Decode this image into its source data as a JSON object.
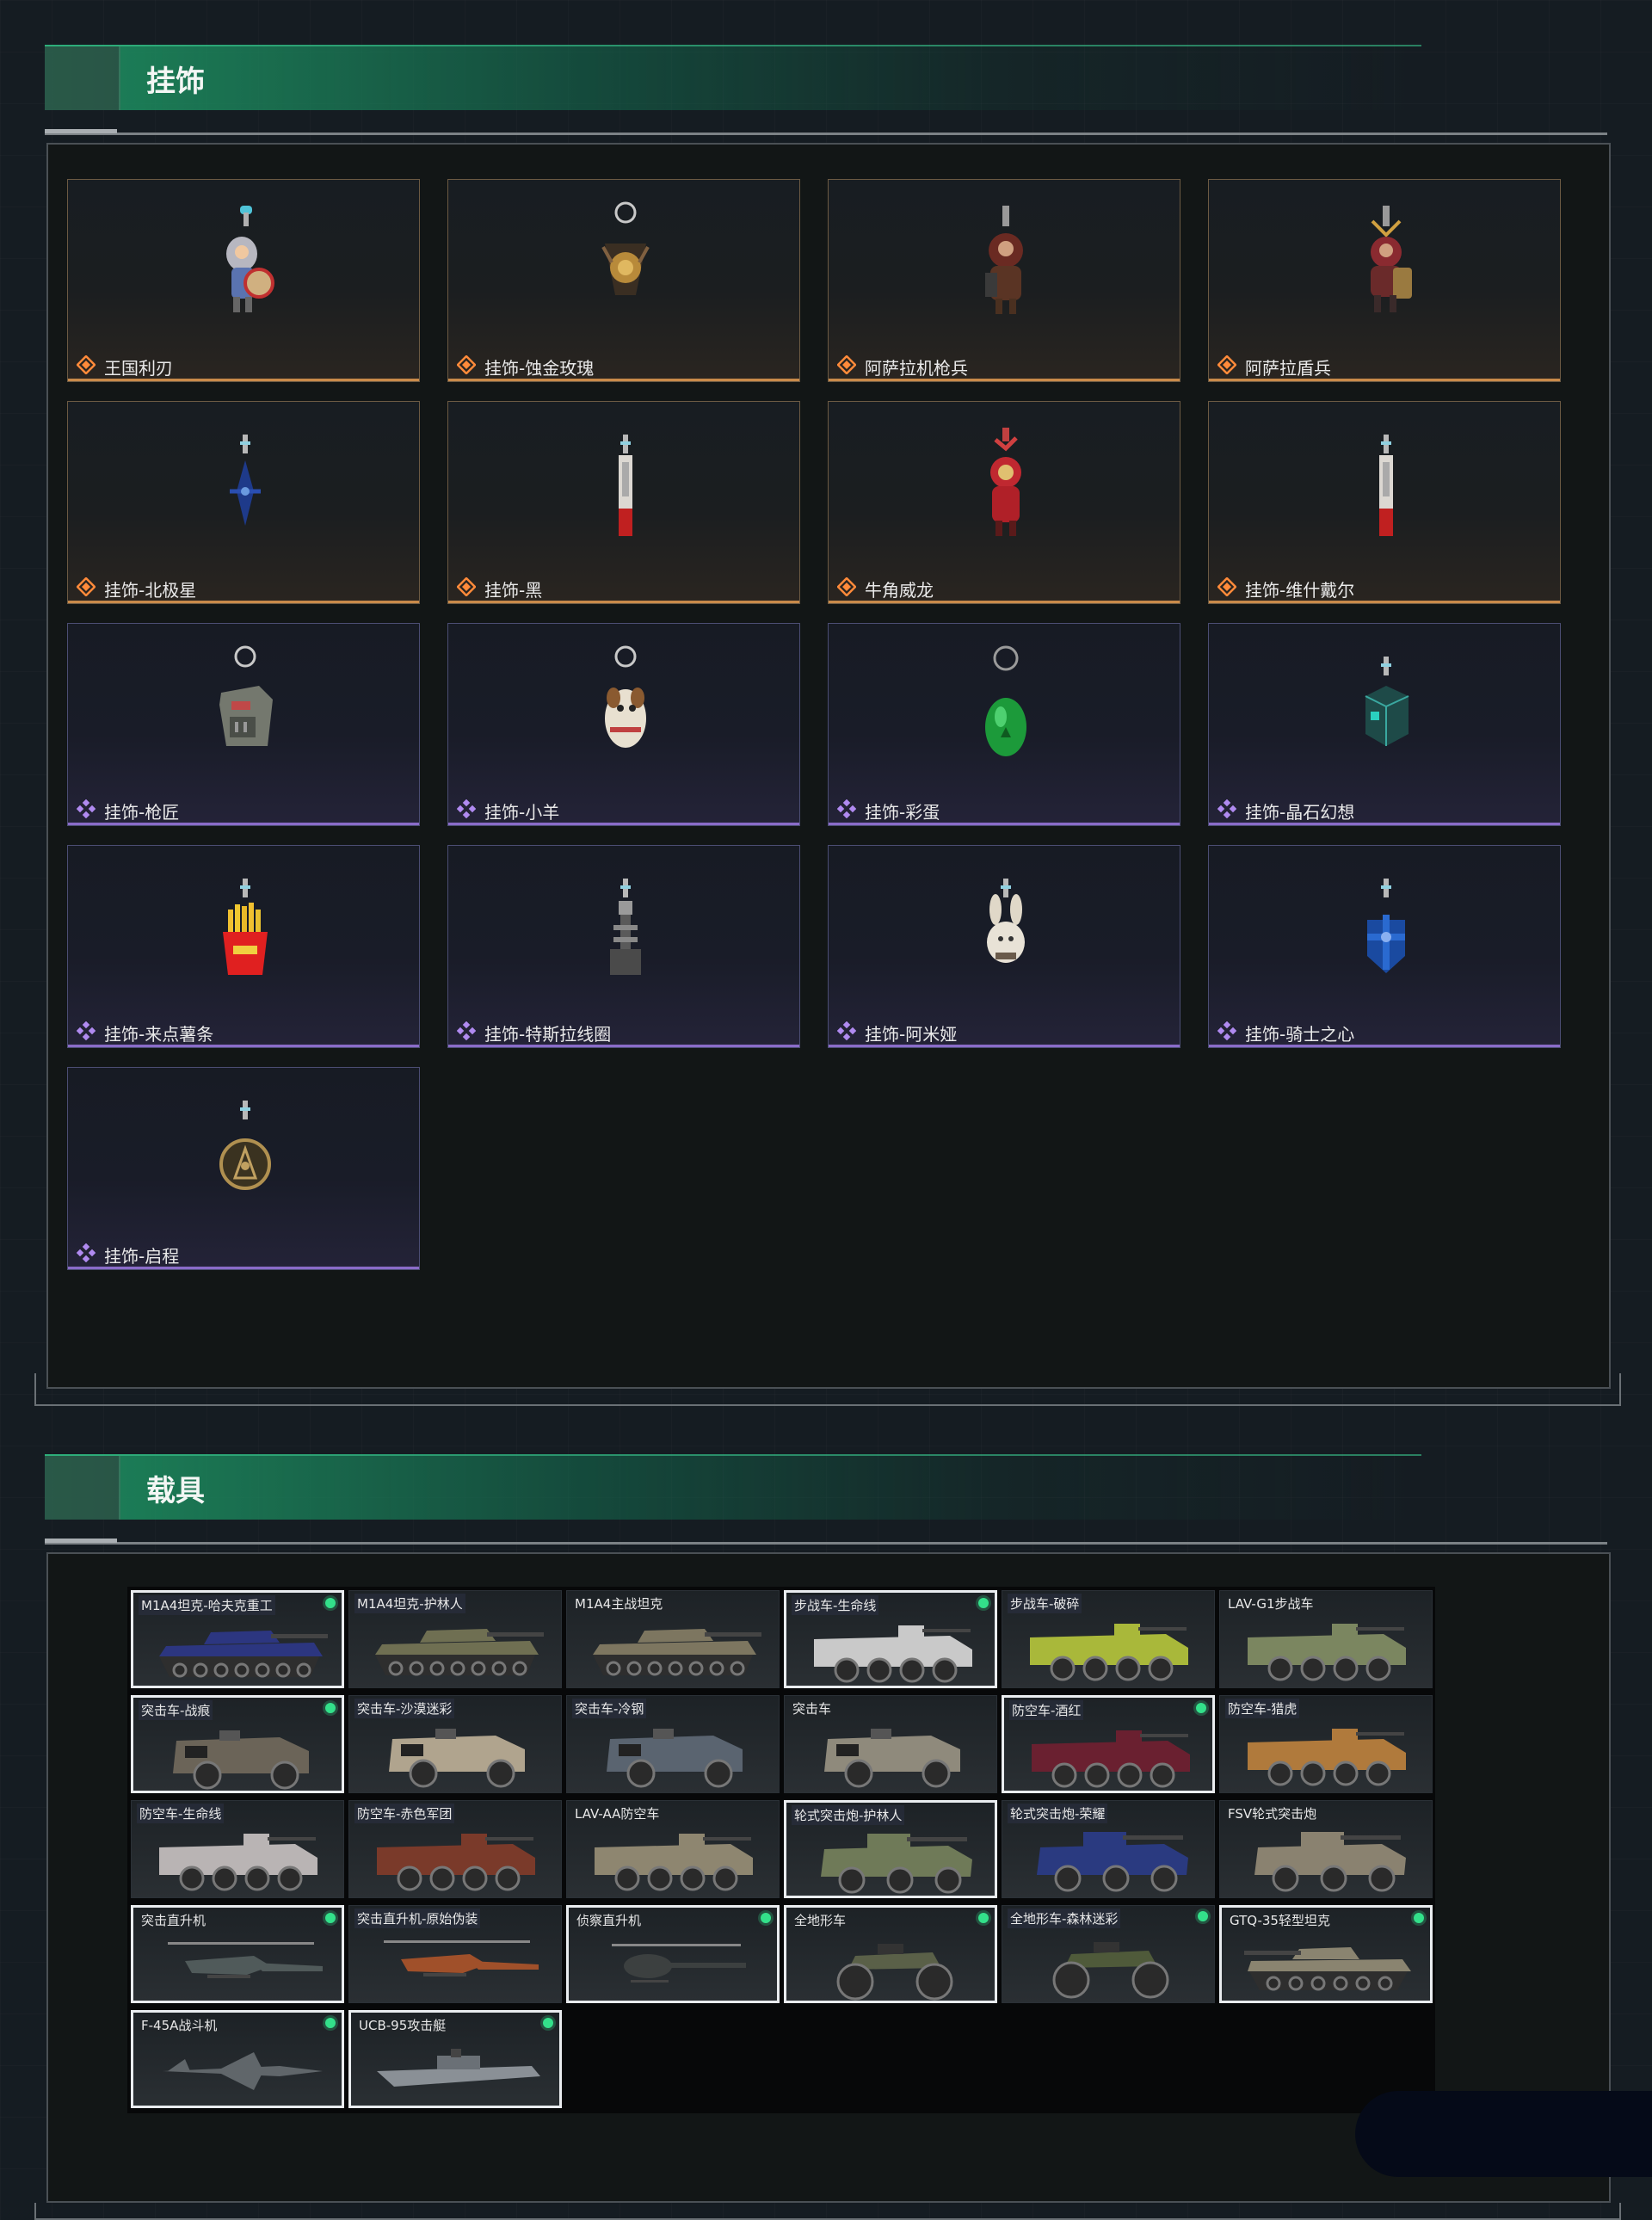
{
  "charms": {
    "title": "挂饰",
    "items": [
      {
        "name": "王国利刃",
        "rarity": "orange",
        "art": "knight"
      },
      {
        "name": "挂饰-蚀金玫瑰",
        "rarity": "orange",
        "art": "rose"
      },
      {
        "name": "阿萨拉机枪兵",
        "rarity": "orange",
        "art": "gunner"
      },
      {
        "name": "阿萨拉盾兵",
        "rarity": "orange",
        "art": "shield"
      },
      {
        "name": "挂饰-北极星",
        "rarity": "orange",
        "art": "polaris"
      },
      {
        "name": "挂饰-黑",
        "rarity": "orange",
        "art": "blade"
      },
      {
        "name": "牛角威龙",
        "rarity": "orange",
        "art": "dragon"
      },
      {
        "name": "挂饰-维什戴尔",
        "rarity": "orange",
        "art": "blade"
      },
      {
        "name": "挂饰-枪匠",
        "rarity": "purple",
        "art": "box"
      },
      {
        "name": "挂饰-小羊",
        "rarity": "purple",
        "art": "sheep"
      },
      {
        "name": "挂饰-彩蛋",
        "rarity": "purple",
        "art": "egg"
      },
      {
        "name": "挂饰-晶石幻想",
        "rarity": "purple",
        "art": "cube"
      },
      {
        "name": "挂饰-来点薯条",
        "rarity": "purple",
        "art": "fries"
      },
      {
        "name": "挂饰-特斯拉线圈",
        "rarity": "purple",
        "art": "coil"
      },
      {
        "name": "挂饰-阿米娅",
        "rarity": "purple",
        "art": "bunny"
      },
      {
        "name": "挂饰-骑士之心",
        "rarity": "purple",
        "art": "cross"
      },
      {
        "name": "挂饰-启程",
        "rarity": "purple",
        "art": "coin"
      }
    ]
  },
  "vehicles": {
    "title": "载具",
    "items": [
      {
        "name": "M1A4坦克-哈夫克重工",
        "selected": true,
        "dot": true,
        "shaded": true,
        "type": "tank",
        "color": "#2c3680"
      },
      {
        "name": "M1A4坦克-护林人",
        "selected": false,
        "dot": false,
        "shaded": true,
        "type": "tank",
        "color": "#6f6f52"
      },
      {
        "name": "M1A4主战坦克",
        "selected": false,
        "dot": false,
        "shaded": false,
        "type": "tank",
        "color": "#7d7660"
      },
      {
        "name": "步战车-生命线",
        "selected": true,
        "dot": true,
        "shaded": true,
        "type": "apc",
        "color": "#c9c9c9"
      },
      {
        "name": "步战车-破碎",
        "selected": false,
        "dot": false,
        "shaded": true,
        "type": "apc",
        "color": "#a9b83a"
      },
      {
        "name": "LAV-G1步战车",
        "selected": false,
        "dot": false,
        "shaded": false,
        "type": "apc",
        "color": "#7b8660"
      },
      {
        "name": "突击车-战痕",
        "selected": true,
        "dot": true,
        "shaded": true,
        "type": "truck",
        "color": "#6b6458"
      },
      {
        "name": "突击车-沙漠迷彩",
        "selected": false,
        "dot": false,
        "shaded": true,
        "type": "truck",
        "color": "#b0a48e"
      },
      {
        "name": "突击车-冷钢",
        "selected": false,
        "dot": false,
        "shaded": true,
        "type": "truck",
        "color": "#5a6470"
      },
      {
        "name": "突击车",
        "selected": false,
        "dot": false,
        "shaded": false,
        "type": "truck",
        "color": "#8f8a7c"
      },
      {
        "name": "防空车-酒红",
        "selected": true,
        "dot": true,
        "shaded": true,
        "type": "apc",
        "color": "#6a2030"
      },
      {
        "name": "防空车-猎虎",
        "selected": false,
        "dot": false,
        "shaded": true,
        "type": "apc",
        "color": "#b07a3c"
      },
      {
        "name": "防空车-生命线",
        "selected": false,
        "dot": false,
        "shaded": true,
        "type": "apc",
        "color": "#b9b4b4"
      },
      {
        "name": "防空车-赤色军团",
        "selected": false,
        "dot": false,
        "shaded": true,
        "type": "apc",
        "color": "#7a3a2a"
      },
      {
        "name": "LAV-AA防空车",
        "selected": false,
        "dot": false,
        "shaded": false,
        "type": "apc",
        "color": "#8e8670"
      },
      {
        "name": "轮式突击炮-护林人",
        "selected": true,
        "dot": false,
        "shaded": true,
        "type": "wheeled",
        "color": "#6f7a58"
      },
      {
        "name": "轮式突击炮-荣耀",
        "selected": false,
        "dot": false,
        "shaded": true,
        "type": "wheeled",
        "color": "#2a3a80"
      },
      {
        "name": "FSV轮式突击炮",
        "selected": false,
        "dot": false,
        "shaded": false,
        "type": "wheeled",
        "color": "#8a8270"
      },
      {
        "name": "突击直升机",
        "selected": true,
        "dot": true,
        "shaded": false,
        "type": "heli",
        "color": "#505a5a"
      },
      {
        "name": "突击直升机-原始伪装",
        "selected": false,
        "dot": false,
        "shaded": true,
        "type": "heli",
        "color": "#a0502a"
      },
      {
        "name": "侦察直升机",
        "selected": true,
        "dot": true,
        "shaded": false,
        "type": "smallheli",
        "color": "#3c4040"
      },
      {
        "name": "全地形车",
        "selected": true,
        "dot": true,
        "shaded": false,
        "type": "atv",
        "color": "#5a6048"
      },
      {
        "name": "全地形车-森林迷彩",
        "selected": false,
        "dot": true,
        "shaded": true,
        "type": "atv",
        "color": "#4f5a3a"
      },
      {
        "name": "GTQ-35轻型坦克",
        "selected": true,
        "dot": true,
        "shaded": false,
        "type": "lighttank",
        "color": "#8a8470"
      },
      {
        "name": "F-45A战斗机",
        "selected": true,
        "dot": true,
        "shaded": false,
        "type": "jet",
        "color": "#60666a"
      },
      {
        "name": "UCB-95攻击艇",
        "selected": true,
        "dot": true,
        "shaded": false,
        "type": "boat",
        "color": "#8a9096"
      }
    ]
  }
}
